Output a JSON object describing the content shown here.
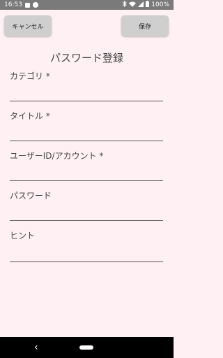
{
  "status_bar": {
    "time": "16:53",
    "battery": "100%",
    "icons": [
      "notification-square-icon",
      "notification-circle-icon",
      "bluetooth-icon",
      "wifi-icon",
      "signal-icon",
      "battery-icon"
    ]
  },
  "toolbar": {
    "cancel_label": "キャンセル",
    "save_label": "保存"
  },
  "page": {
    "title": "パスワード登録"
  },
  "fields": [
    {
      "label": "カテゴリ *",
      "value": ""
    },
    {
      "label": "タイトル *",
      "value": ""
    },
    {
      "label": "ユーザーID/アカウント *",
      "value": ""
    },
    {
      "label": "パスワード",
      "value": ""
    },
    {
      "label": "ヒント",
      "value": ""
    }
  ],
  "colors": {
    "background": "#fff0f3",
    "button": "#cfcfcf",
    "status_bar": "#7a7a7a",
    "nav_bar": "#000000"
  }
}
